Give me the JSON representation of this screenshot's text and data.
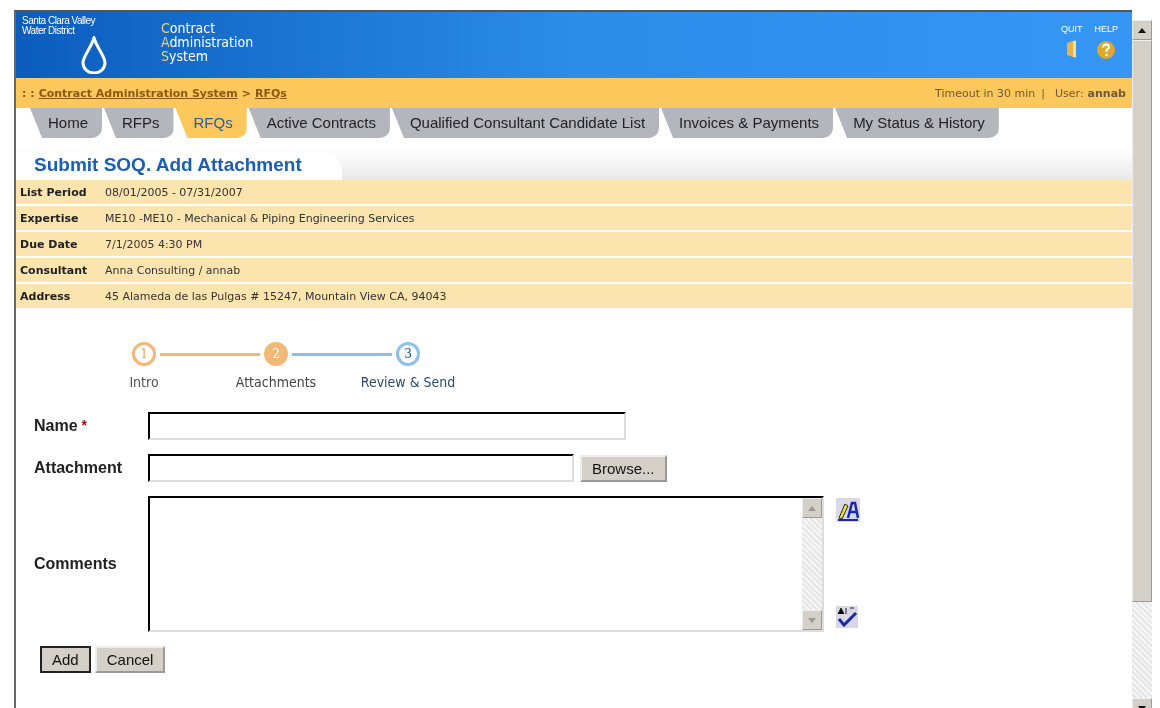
{
  "header": {
    "logo_lines": [
      "Santa Clara Valley",
      "Water District"
    ],
    "app_title_lines": [
      "Contract",
      "Administration",
      "System"
    ],
    "actions": [
      {
        "label": "QUIT",
        "kind": "quit"
      },
      {
        "label": "HELP",
        "kind": "help"
      }
    ]
  },
  "breadcrumb": {
    "prefix": ": :",
    "links": [
      "Contract Administration System",
      "RFQs"
    ],
    "separator": ">",
    "timeout": "Timeout in 30 min",
    "divider": "|",
    "user_label": "User:",
    "user": "annab"
  },
  "tabs": [
    {
      "label": "Home",
      "selected": false
    },
    {
      "label": "RFPs",
      "selected": false
    },
    {
      "label": "RFQs",
      "selected": true
    },
    {
      "label": "Active Contracts",
      "selected": false
    },
    {
      "label": "Qualified Consultant Candidate List",
      "selected": false
    },
    {
      "label": "Invoices & Payments",
      "selected": false
    },
    {
      "label": "My Status & History",
      "selected": false
    }
  ],
  "page_title": "Submit SOQ. Add Attachment",
  "details": [
    {
      "label": "List Period",
      "value": "08/01/2005 - 07/31/2007"
    },
    {
      "label": "Expertise",
      "value": "ME10 -ME10 - Mechanical & Piping Engineering Services"
    },
    {
      "label": "Due Date",
      "value": "7/1/2005 4:30 PM"
    },
    {
      "label": "Consultant",
      "value": "Anna Consulting / annab"
    },
    {
      "label": "Address",
      "value": "45 Alameda de las Pulgas # 15247, Mountain View CA, 94043"
    }
  ],
  "steps": [
    {
      "number": "1",
      "label": "Intro",
      "kind": "done"
    },
    {
      "number": "2",
      "label": "Attachments",
      "kind": "current"
    },
    {
      "number": "3",
      "label": "Review & Send",
      "kind": "upcoming"
    }
  ],
  "form": {
    "name_label": "Name",
    "required_mark": "*",
    "attachment_label": "Attachment",
    "browse_button": "Browse...",
    "comments_label": "Comments"
  },
  "buttons": [
    "Add",
    "Cancel"
  ]
}
